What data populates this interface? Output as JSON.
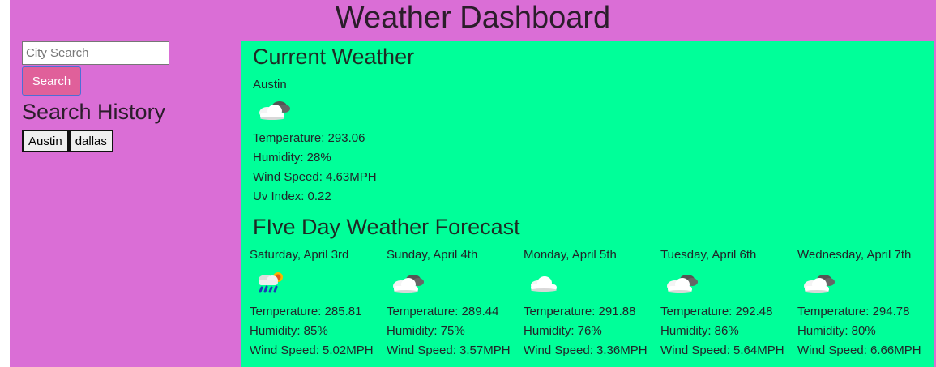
{
  "header": {
    "title": "Weather Dashboard"
  },
  "sidebar": {
    "search_placeholder": "City Search",
    "search_value": "",
    "search_button": "Search",
    "history_title": "Search History",
    "history": [
      "Austin",
      "dallas"
    ]
  },
  "current": {
    "title": "Current Weather",
    "city": "Austin",
    "icon": "partly-cloudy-icon",
    "temperature": "Temperature: 293.06",
    "humidity": "Humidity: 28%",
    "wind": "Wind Speed: 4.63MPH",
    "uv": "Uv Index: 0.22"
  },
  "forecast": {
    "title": "FIve Day Weather Forecast",
    "days": [
      {
        "date": "Saturday, April 3rd",
        "icon": "rain-sun-icon",
        "temperature": "Temperature: 285.81",
        "humidity": "Humidity: 85%",
        "wind": "Wind Speed: 5.02MPH"
      },
      {
        "date": "Sunday, April 4th",
        "icon": "broken-clouds-icon",
        "temperature": "Temperature: 289.44",
        "humidity": "Humidity: 75%",
        "wind": "Wind Speed: 3.57MPH"
      },
      {
        "date": "Monday, April 5th",
        "icon": "cloud-icon",
        "temperature": "Temperature: 291.88",
        "humidity": "Humidity: 76%",
        "wind": "Wind Speed: 3.36MPH"
      },
      {
        "date": "Tuesday, April 6th",
        "icon": "broken-clouds-icon",
        "temperature": "Temperature: 292.48",
        "humidity": "Humidity: 86%",
        "wind": "Wind Speed: 5.64MPH"
      },
      {
        "date": "Wednesday, April 7th",
        "icon": "broken-clouds-icon",
        "temperature": "Temperature: 294.78",
        "humidity": "Humidity: 80%",
        "wind": "Wind Speed: 6.66MPH"
      }
    ]
  },
  "colors": {
    "page_bg": "#da6ed6",
    "main_bg": "#00ff99",
    "search_button_bg": "#e0609a"
  }
}
